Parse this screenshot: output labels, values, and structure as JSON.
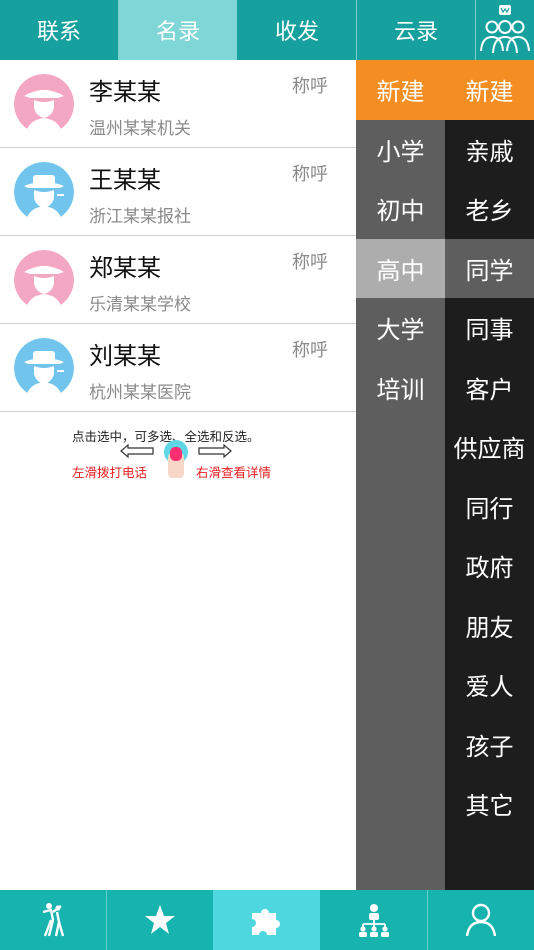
{
  "colors": {
    "teal": "#16a19e",
    "active_tab": "#7ed7d6",
    "orange": "#f58e22",
    "dark_gray": "#5e5e5e",
    "black": "#1d1d1d",
    "pink": "#f3a7c2",
    "blue": "#71c4ec"
  },
  "top_tabs": [
    {
      "label": "联系"
    },
    {
      "label": "名录"
    },
    {
      "label": "收发"
    },
    {
      "label": "云录"
    }
  ],
  "top_group_icon": "group-icon",
  "contacts": [
    {
      "name": "李某某",
      "org": "温州某某机关",
      "title": "称呼",
      "avatar": "pink"
    },
    {
      "name": "王某某",
      "org": "浙江某某报社",
      "title": "称呼",
      "avatar": "blue"
    },
    {
      "name": "郑某某",
      "org": "乐清某某学校",
      "title": "称呼",
      "avatar": "pink"
    },
    {
      "name": "刘某某",
      "org": "杭州某某医院",
      "title": "称呼",
      "avatar": "blue"
    }
  ],
  "hint": {
    "top": "点击选中，可多选、全选和反选。",
    "left": "左滑拨打电话",
    "right": "右滑查看详情"
  },
  "middle_categories": [
    "新建",
    "小学",
    "初中",
    "高中",
    "大学",
    "培训"
  ],
  "right_categories": [
    "新建",
    "亲戚",
    "老乡",
    "同学",
    "同事",
    "客户",
    "供应商",
    "同行",
    "政府",
    "朋友",
    "爱人",
    "孩子",
    "其它"
  ],
  "bottom_nav": [
    "dance-icon",
    "star-icon",
    "puzzle-icon",
    "org-chart-icon",
    "person-icon"
  ]
}
